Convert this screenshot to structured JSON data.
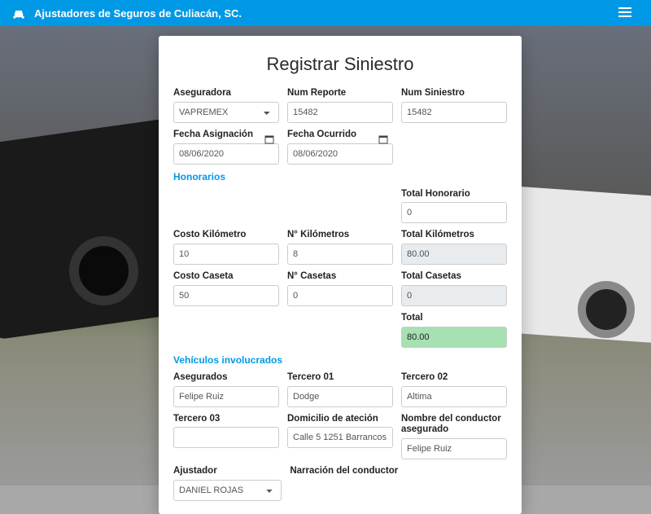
{
  "topbar": {
    "title": "Ajustadores de Seguros de Culiacán, SC."
  },
  "form": {
    "title": "Registrar Siniestro",
    "aseguradora": {
      "label": "Aseguradora",
      "value": "VAPREMEX"
    },
    "num_reporte": {
      "label": "Num Reporte",
      "value": "15482"
    },
    "num_siniestro": {
      "label": "Num Siniestro",
      "value": "15482"
    },
    "fecha_asignacion": {
      "label": "Fecha Asignación",
      "value": "08/06/2020"
    },
    "fecha_ocurrido": {
      "label": "Fecha Ocurrido",
      "value": "08/06/2020"
    },
    "honorarios_h": "Honorarios",
    "total_honorario": {
      "label": "Total Honorario",
      "value": "0"
    },
    "costo_km": {
      "label": "Costo Kilómetro",
      "value": "10"
    },
    "n_km": {
      "label": "N° Kilómetros",
      "value": "8"
    },
    "total_km": {
      "label": "Total Kilómetros",
      "value": "80.00"
    },
    "costo_caseta": {
      "label": "Costo Caseta",
      "value": "50"
    },
    "n_casetas": {
      "label": "N° Casetas",
      "value": "0"
    },
    "total_casetas": {
      "label": "Total Casetas",
      "value": "0"
    },
    "total": {
      "label": "Total",
      "value": "80.00"
    },
    "vehiculos_h": "Vehículos involucrados",
    "asegurados": {
      "label": "Asegurados",
      "value": "Felipe Ruiz"
    },
    "tercero01": {
      "label": "Tercero 01",
      "value": "Dodge"
    },
    "tercero02": {
      "label": "Tercero 02",
      "value": "Altima"
    },
    "tercero03": {
      "label": "Tercero 03",
      "value": ""
    },
    "domicilio": {
      "label": "Domicilio de ateción",
      "value": "Calle 5 1251 Barrancos"
    },
    "conductor_asegurado": {
      "label": "Nombre del conductor asegurado",
      "value": "Felipe Ruiz"
    },
    "ajustador": {
      "label": "Ajustador",
      "value": "DANIEL ROJAS"
    },
    "narracion": {
      "label": "Narración del conductor"
    }
  }
}
